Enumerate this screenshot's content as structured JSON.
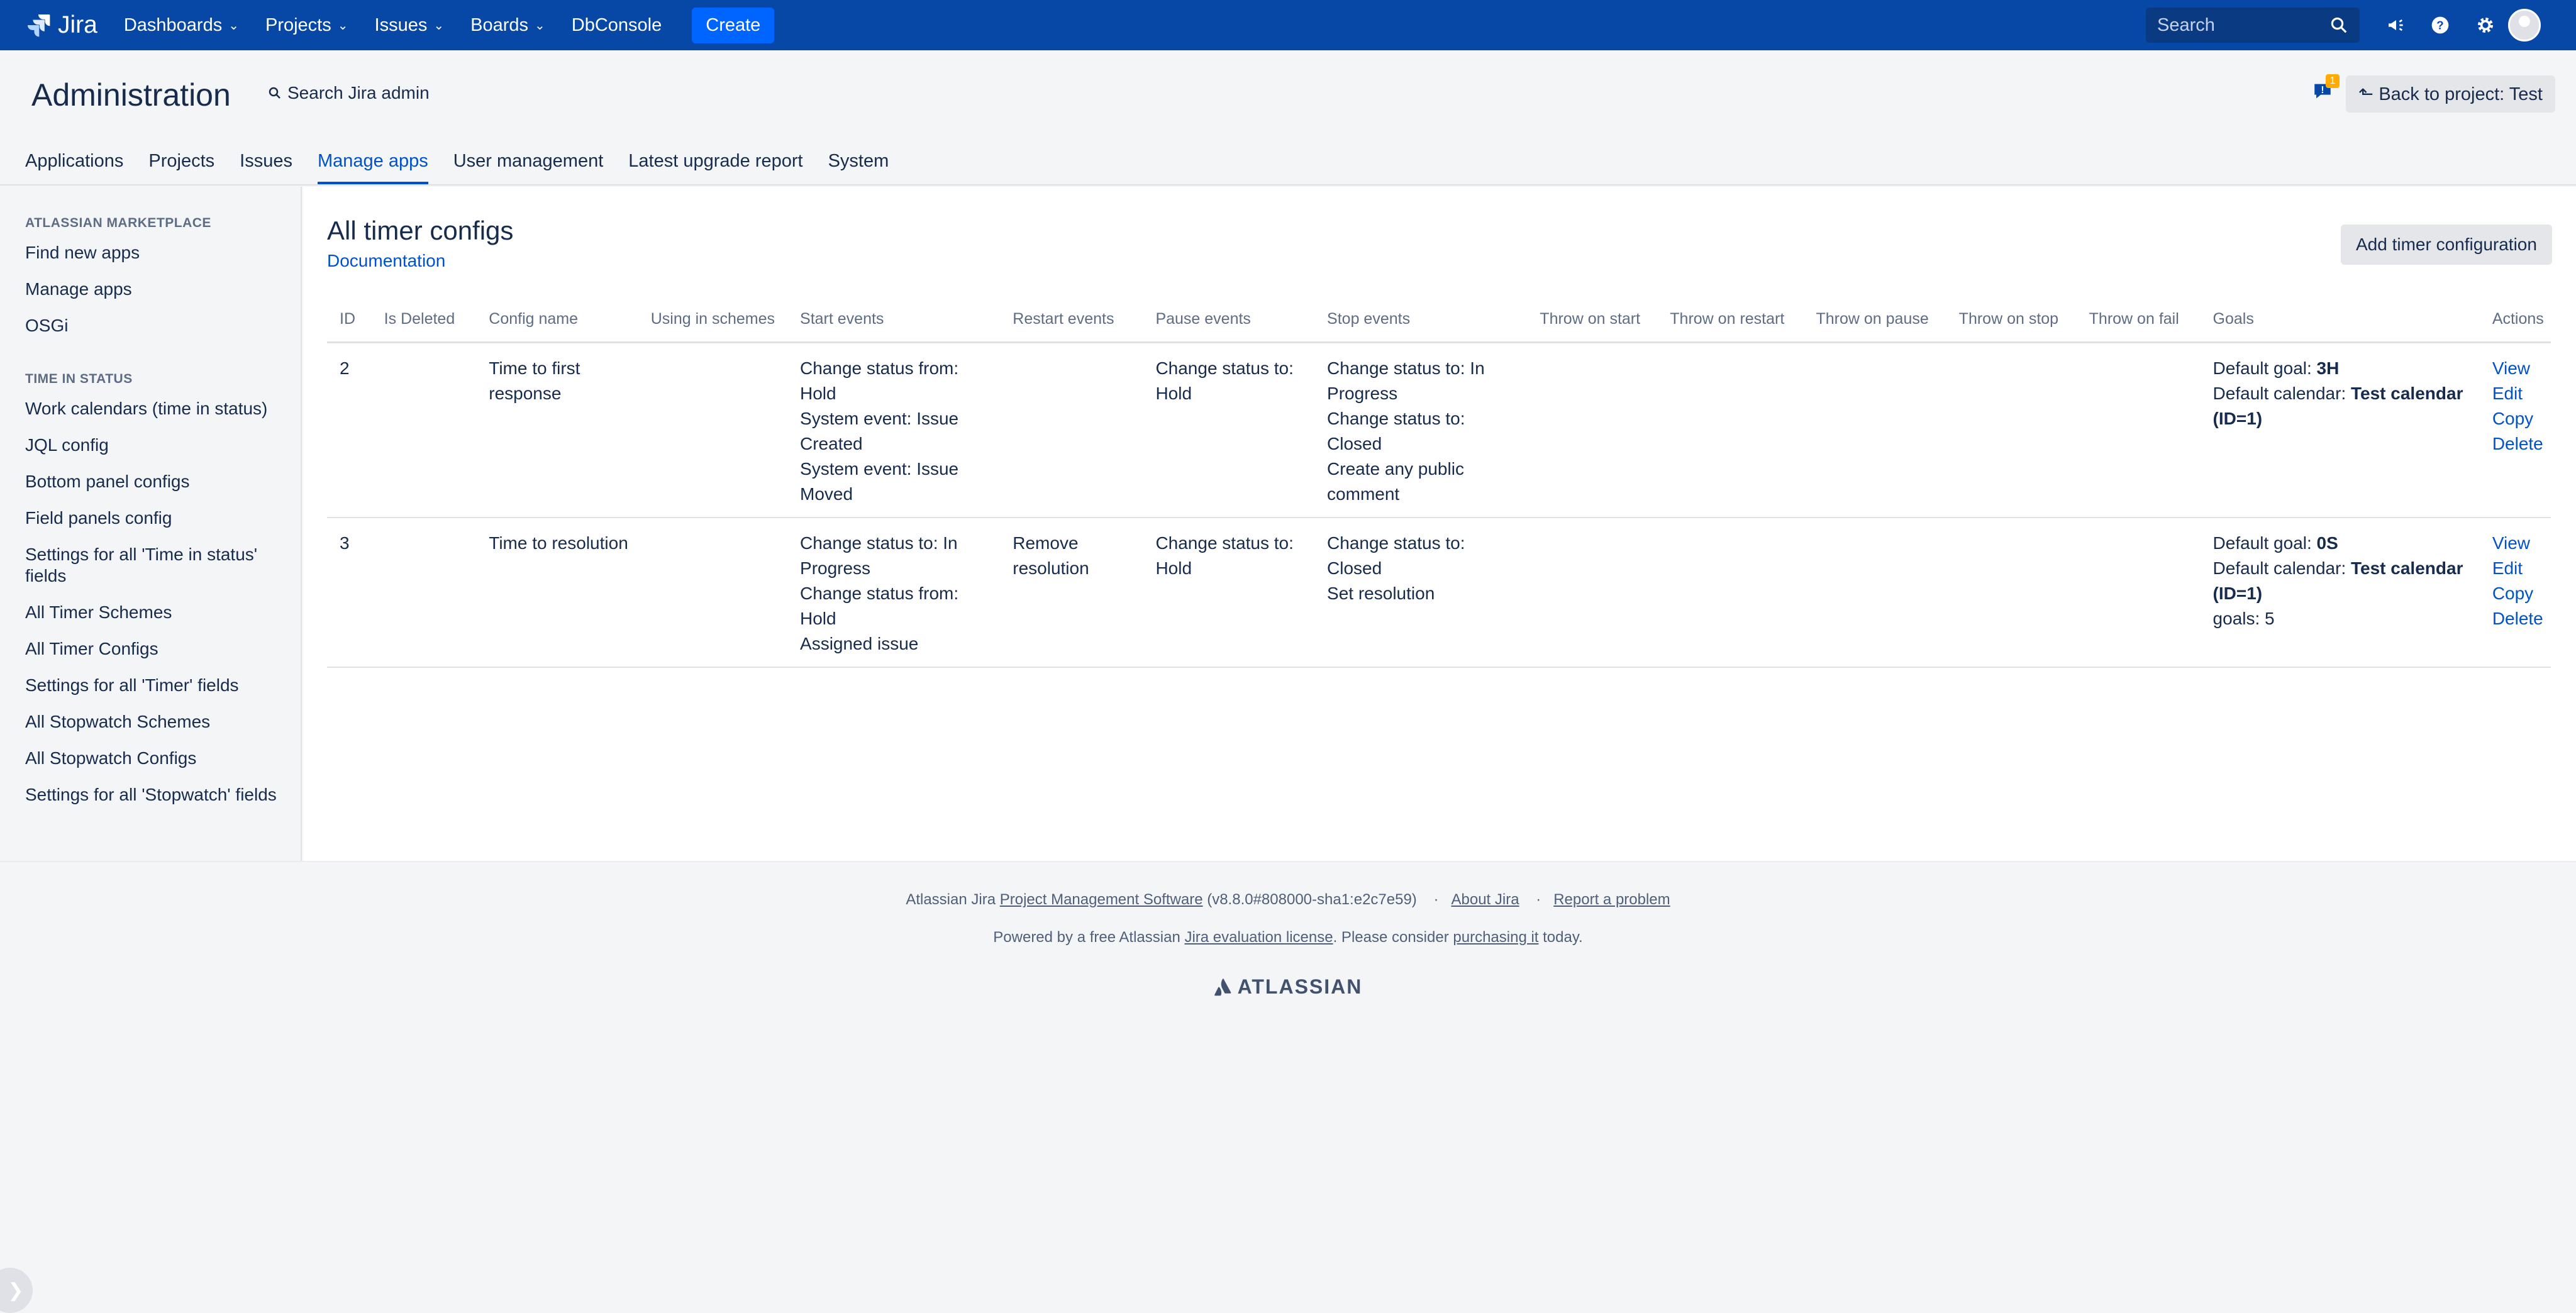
{
  "topnav": {
    "logo_text": "Jira",
    "items": [
      {
        "label": "Dashboards",
        "has_menu": true
      },
      {
        "label": "Projects",
        "has_menu": true
      },
      {
        "label": "Issues",
        "has_menu": true
      },
      {
        "label": "Boards",
        "has_menu": true
      },
      {
        "label": "DbConsole",
        "has_menu": false
      }
    ],
    "create_label": "Create",
    "search_placeholder": "Search",
    "icons": [
      "notifications-icon",
      "help-icon",
      "settings-icon",
      "avatar"
    ]
  },
  "admin": {
    "title": "Administration",
    "search_label": "Search Jira admin",
    "back_button": "Back to project: Test",
    "notification_count": "1",
    "tabs": [
      {
        "label": "Applications",
        "active": false
      },
      {
        "label": "Projects",
        "active": false
      },
      {
        "label": "Issues",
        "active": false
      },
      {
        "label": "Manage apps",
        "active": true
      },
      {
        "label": "User management",
        "active": false
      },
      {
        "label": "Latest upgrade report",
        "active": false
      },
      {
        "label": "System",
        "active": false
      }
    ]
  },
  "sidebar": {
    "section1_heading": "ATLASSIAN MARKETPLACE",
    "section1_items": [
      "Find new apps",
      "Manage apps",
      "OSGi"
    ],
    "section2_heading": "TIME IN STATUS",
    "section2_items": [
      "Work calendars (time in status)",
      "JQL config",
      "Bottom panel configs",
      "Field panels config",
      "Settings for all 'Time in status' fields",
      "All Timer Schemes",
      "All Timer Configs",
      "Settings for all 'Timer' fields",
      "All Stopwatch Schemes",
      "All Stopwatch Configs",
      "Settings for all 'Stopwatch' fields"
    ]
  },
  "main": {
    "title": "All timer configs",
    "documentation_link": "Documentation",
    "add_button": "Add timer configuration",
    "columns": [
      "ID",
      "Is Deleted",
      "Config name",
      "Using in schemes",
      "Start events",
      "Restart events",
      "Pause events",
      "Stop events",
      "Throw on start",
      "Throw on restart",
      "Throw on pause",
      "Throw on stop",
      "Throw on fail",
      "Goals",
      "Actions"
    ],
    "rows": [
      {
        "id": "2",
        "is_deleted": "",
        "config_name": "Time to first response",
        "using_in_schemes": "",
        "start_events": [
          "Change status from: Hold",
          "System event: Issue Created",
          "System event: Issue Moved"
        ],
        "restart_events": [],
        "pause_events": [
          "Change status to: Hold"
        ],
        "stop_events": [
          "Change status to: In Progress",
          "Change status to: Closed",
          "Create any public comment"
        ],
        "throw_on_start": "",
        "throw_on_restart": "",
        "throw_on_pause": "",
        "throw_on_stop": "",
        "throw_on_fail": "",
        "goal_label": "Default goal: ",
        "goal_value": "3H",
        "calendar_label": "Default calendar: ",
        "calendar_value": "Test calendar (ID=1)",
        "extra_goals": "",
        "actions": [
          "View",
          "Edit",
          "Copy",
          "Delete"
        ]
      },
      {
        "id": "3",
        "is_deleted": "",
        "config_name": "Time to resolution",
        "using_in_schemes": "",
        "start_events": [
          "Change status to: In Progress",
          "Change status from: Hold",
          "Assigned issue"
        ],
        "restart_events": [
          "Remove resolution"
        ],
        "pause_events": [
          "Change status to: Hold"
        ],
        "stop_events": [
          "Change status to: Closed",
          "Set resolution"
        ],
        "throw_on_start": "",
        "throw_on_restart": "",
        "throw_on_pause": "",
        "throw_on_stop": "",
        "throw_on_fail": "",
        "goal_label": "Default goal: ",
        "goal_value": "0S",
        "calendar_label": "Default calendar: ",
        "calendar_value": "Test calendar (ID=1)",
        "extra_goals": "goals: 5",
        "actions": [
          "View",
          "Edit",
          "Copy",
          "Delete"
        ]
      }
    ]
  },
  "footer": {
    "line1_prefix": "Atlassian Jira ",
    "line1_link": "Project Management Software",
    "line1_version": " (v8.8.0#808000-sha1:e2c7e59)",
    "about_link": "About Jira",
    "report_link": "Report a problem",
    "line2_prefix": "Powered by a free Atlassian ",
    "line2_link": "Jira evaluation license",
    "line2_middle": ". Please consider ",
    "line2_link2": "purchasing it",
    "line2_suffix": " today.",
    "brand": "ATLASSIAN"
  },
  "colors": {
    "topnav_bg": "#0747a6",
    "create_bg": "#0065ff",
    "link": "#0052cc",
    "text": "#172b4d",
    "muted": "#5e6c84"
  }
}
